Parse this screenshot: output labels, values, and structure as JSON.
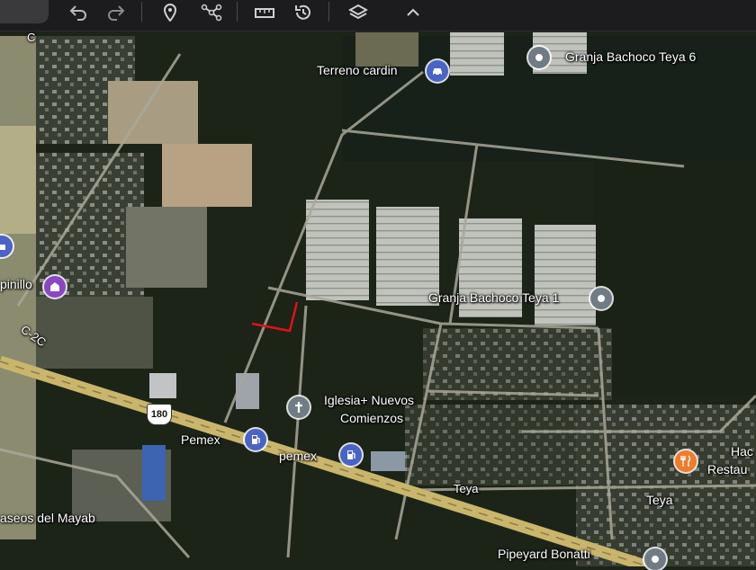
{
  "toolbar": {
    "buttons": [
      {
        "name": "undo",
        "icon": "undo-icon"
      },
      {
        "name": "redo",
        "icon": "redo-icon"
      },
      {
        "name": "add-placemark",
        "icon": "map-pin-icon"
      },
      {
        "name": "draw-path",
        "icon": "path-icon"
      },
      {
        "name": "measure",
        "icon": "ruler-icon"
      },
      {
        "name": "historical-imagery",
        "icon": "history-icon"
      },
      {
        "name": "layers",
        "icon": "layers-icon"
      },
      {
        "name": "collapse",
        "icon": "chevron-up-icon"
      }
    ]
  },
  "map": {
    "labels": {
      "terreno_cardin": "Terreno cardin",
      "granja_teya6": "Granja Bachoco Teya 6",
      "granja_teya1": "Granja Bachoco Teya 1",
      "iglesia_line1": "Iglesia+ Nuevos",
      "iglesia_line2": "Comienzos",
      "pemex_1": "Pemex",
      "pemex_2": "pemex",
      "teya_road": "Teya",
      "teya_town": "Teya",
      "paseos": "aseos del Mayab",
      "pipeyard": "Pipeyard Bonatti",
      "pinillo": "pinillo",
      "c2c": "C-2C",
      "c_top": "C",
      "hac_line1": "Hac",
      "hac_line2": "Restau"
    },
    "route_shield": "180",
    "colors": {
      "highway": "#c9b56c",
      "boundary": "#e3101a",
      "pin_blue": "#4a63c7",
      "pin_grey": "#6f7c86",
      "pin_purple": "#8a46c4",
      "pin_orange": "#ef7b2c"
    }
  }
}
